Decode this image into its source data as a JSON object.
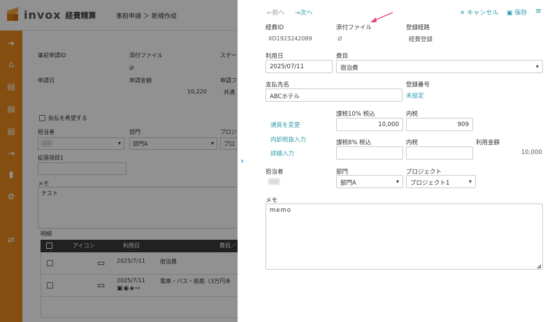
{
  "app": {
    "brand": "invox",
    "product": "経費精算",
    "breadcrumb": "事前申請 ＞ 新規作成"
  },
  "background": {
    "labels": {
      "request_id": "事前申請ID",
      "attachment": "添付ファイル",
      "status": "ステー",
      "apply_date": "申請日",
      "amount": "申請金額",
      "apply_col": "申請フ",
      "amount_value": "10,220",
      "common": "共通",
      "advance": "仮払を希望する",
      "assignee": "担当者",
      "dept": "部門",
      "project": "プロジ",
      "dept_value": "部門A",
      "project_value": "プロ",
      "extension": "拡張項目1",
      "memo": "メモ",
      "memo_value": "テスト",
      "details": "明細"
    },
    "table": {
      "headers": [
        "アイコン",
        "利用日",
        "費目／"
      ],
      "rows": [
        {
          "date": "2025/7/11",
          "category": "宿泊費"
        },
        {
          "date": "2025/7/11",
          "category": "電車・バス・船舶（3万円未"
        }
      ]
    }
  },
  "panel": {
    "nav": {
      "prev": "前へ",
      "next": "次へ",
      "cancel": "キャンセル",
      "save": "保存"
    },
    "fields": {
      "expense_id_label": "経費ID",
      "expense_id": "XD1923242089",
      "attachment_label": "添付ファイル",
      "route_label": "登録経路",
      "route": "経費登録",
      "use_date_label": "利用日",
      "use_date": "2025/07/11",
      "category_label": "費目",
      "category": "宿泊費",
      "payee_label": "支払先名",
      "payee": "ABCホテル",
      "reg_no_label": "登録番号",
      "reg_no": "未設定",
      "currency_link": "通貨を変更",
      "tax_breakdown_link": "内訳税抜入力",
      "detail_link": "詳細入力",
      "tax10_label": "課税10% 税込",
      "tax10_value": "10,000",
      "inner_tax_label": "内税",
      "inner_tax10_value": "909",
      "tax8_label": "課税8% 税込",
      "inner_tax8_label": "内税",
      "total_label": "利用金額",
      "total_value": "10,000",
      "assignee_label": "担当者",
      "dept_label": "部門",
      "dept": "部門A",
      "project_label": "プロジェクト",
      "project": "プロジェクト1",
      "memo_label": "メモ",
      "memo": "memo"
    }
  },
  "colors": {
    "accent": "#e8891e",
    "link": "#2e9ba8",
    "annotation_arrow": "#e8457a"
  }
}
